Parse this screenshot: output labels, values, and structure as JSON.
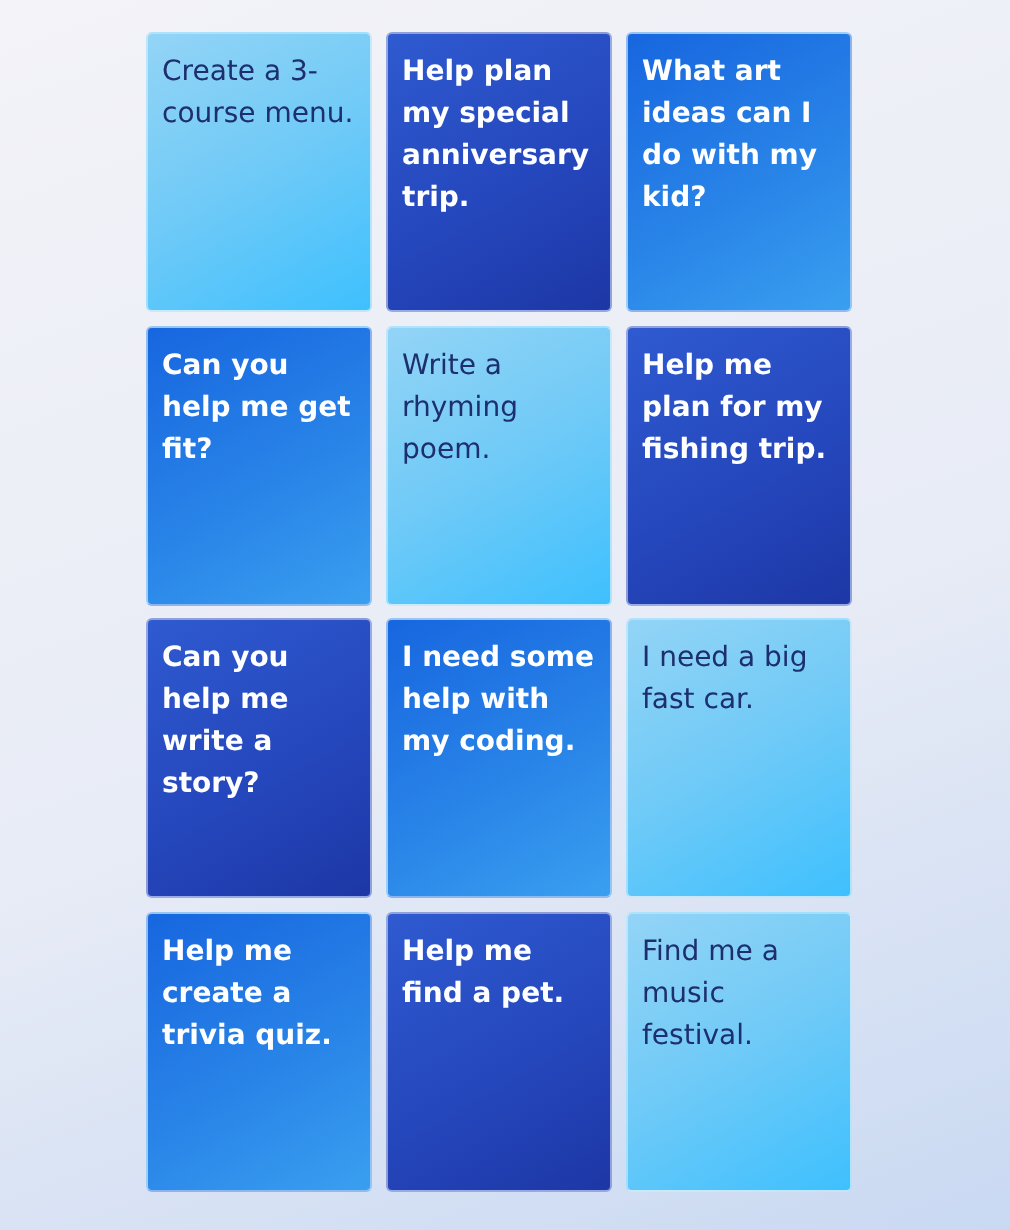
{
  "cards": [
    {
      "text": "Create a 3-course menu.",
      "kind": "light"
    },
    {
      "text": "Help plan my special anniversary trip.",
      "kind": "dark"
    },
    {
      "text": "What art ideas can I do with my kid?",
      "kind": "blue"
    },
    {
      "text": "Can you help me get fit?",
      "kind": "blue"
    },
    {
      "text": "Write a rhyming poem.",
      "kind": "light"
    },
    {
      "text": "Help me plan for my fishing trip.",
      "kind": "dark"
    },
    {
      "text": "Can you help me write a story?",
      "kind": "dark"
    },
    {
      "text": "I need some help with my coding.",
      "kind": "blue"
    },
    {
      "text": "I need a big fast car.",
      "kind": "light"
    },
    {
      "text": "Help me create a trivia quiz.",
      "kind": "blue"
    },
    {
      "text": "Help me find a pet.",
      "kind": "dark"
    },
    {
      "text": "Find me a music festival.",
      "kind": "light"
    }
  ]
}
